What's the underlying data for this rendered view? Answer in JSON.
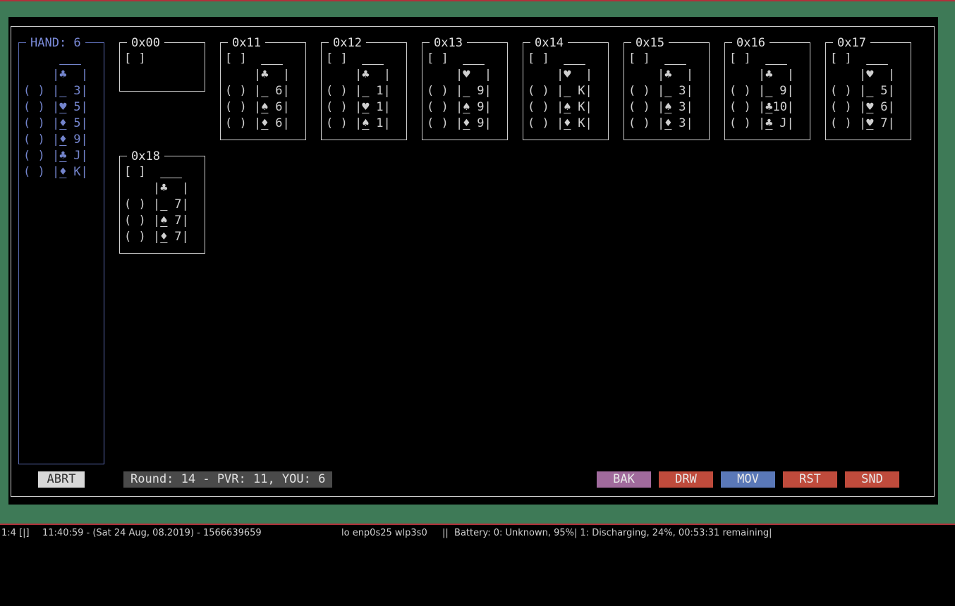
{
  "hand": {
    "title": "HAND: 6",
    "top_suit": "♣",
    "cards": [
      {
        "check": "( )",
        "suit": " ",
        "rank": "3"
      },
      {
        "check": "( )",
        "suit": "♥",
        "rank": "5"
      },
      {
        "check": "( )",
        "suit": "♦",
        "rank": "5"
      },
      {
        "check": "( )",
        "suit": "♦",
        "rank": "9"
      },
      {
        "check": "( )",
        "suit": "♣",
        "rank": "J"
      },
      {
        "check": "( )",
        "suit": "♦",
        "rank": "K"
      }
    ]
  },
  "piles": [
    {
      "title": "0x00",
      "select": "[ ]",
      "top_suit": "",
      "cards": []
    },
    {
      "title": "0x11",
      "select": "[ ]",
      "top_suit": "♣",
      "cards": [
        {
          "check": "( )",
          "suit": " ",
          "rank": "6"
        },
        {
          "check": "( )",
          "suit": "♠",
          "rank": "6"
        },
        {
          "check": "( )",
          "suit": "♦",
          "rank": "6"
        }
      ]
    },
    {
      "title": "0x12",
      "select": "[ ]",
      "top_suit": "♣",
      "cards": [
        {
          "check": "( )",
          "suit": " ",
          "rank": "1"
        },
        {
          "check": "( )",
          "suit": "♥",
          "rank": "1"
        },
        {
          "check": "( )",
          "suit": "♠",
          "rank": "1"
        }
      ]
    },
    {
      "title": "0x13",
      "select": "[ ]",
      "top_suit": "♥",
      "cards": [
        {
          "check": "( )",
          "suit": " ",
          "rank": "9"
        },
        {
          "check": "( )",
          "suit": "♠",
          "rank": "9"
        },
        {
          "check": "( )",
          "suit": "♦",
          "rank": "9"
        }
      ]
    },
    {
      "title": "0x14",
      "select": "[ ]",
      "top_suit": "♥",
      "cards": [
        {
          "check": "( )",
          "suit": " ",
          "rank": "K"
        },
        {
          "check": "( )",
          "suit": "♠",
          "rank": "K"
        },
        {
          "check": "( )",
          "suit": "♦",
          "rank": "K"
        }
      ]
    },
    {
      "title": "0x15",
      "select": "[ ]",
      "top_suit": "♣",
      "cards": [
        {
          "check": "( )",
          "suit": " ",
          "rank": "3"
        },
        {
          "check": "( )",
          "suit": "♠",
          "rank": "3"
        },
        {
          "check": "( )",
          "suit": "♦",
          "rank": "3"
        }
      ]
    },
    {
      "title": "0x16",
      "select": "[ ]",
      "top_suit": "♣",
      "cards": [
        {
          "check": "( )",
          "suit": " ",
          "rank": "9"
        },
        {
          "check": "( )",
          "suit": "♣",
          "rank": "10"
        },
        {
          "check": "( )",
          "suit": "♣",
          "rank": "J"
        }
      ]
    },
    {
      "title": "0x17",
      "select": "[ ]",
      "top_suit": "♥",
      "cards": [
        {
          "check": "( )",
          "suit": " ",
          "rank": "5"
        },
        {
          "check": "( )",
          "suit": "♥",
          "rank": "6"
        },
        {
          "check": "( )",
          "suit": "♥",
          "rank": "7"
        }
      ]
    },
    {
      "title": "0x18",
      "select": "[ ]",
      "top_suit": "♣",
      "cards": [
        {
          "check": "( )",
          "suit": " ",
          "rank": "7"
        },
        {
          "check": "( )",
          "suit": "♠",
          "rank": "7"
        },
        {
          "check": "( )",
          "suit": "♦",
          "rank": "7"
        }
      ]
    }
  ],
  "controls": {
    "abort": "ABRT",
    "round_info": "Round: 14 - PVR: 11, YOU: 6",
    "back": "BAK",
    "draw": "DRW",
    "move": "MOV",
    "reset": "RST",
    "send": "SND"
  },
  "colors": {
    "back": "#a06a9c",
    "draw": "#bf4b3c",
    "move": "#5a78b8",
    "reset": "#bf4b3c",
    "send": "#bf4b3c",
    "abort_bg": "#d8d8d8",
    "abort_fg": "#303030"
  },
  "taskbar": {
    "workspace": "1:4 [|]",
    "datetime": "11:40:59 - (Sat 24 Aug, 08.2019) - 1566639659",
    "network": "lo enp0s25 wlp3s0",
    "battery": "||  Battery: 0: Unknown, 95%| 1: Discharging, 24%, 00:53:31 remaining|"
  }
}
